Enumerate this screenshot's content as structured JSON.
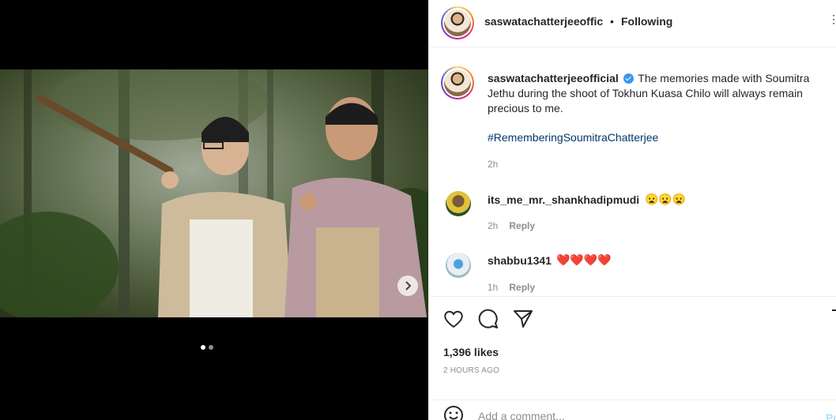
{
  "post": {
    "username": "saswatachatterjeeoffic",
    "separator": "•",
    "follow_status": "Following",
    "more": "⋮"
  },
  "caption": {
    "username": "saswatachatterjeeofficial",
    "text": "The memories made with Soumitra Jethu during the shoot of Tokhun Kuasa Chilo will always remain precious to me.",
    "hashtag": "#RememberingSoumitraChatterjee",
    "age": "2h"
  },
  "comments": [
    {
      "username": "its_me_mr._shankhadipmudi",
      "text": "😦😦😦",
      "age": "2h",
      "reply": "Reply"
    },
    {
      "username": "shabbu1341",
      "text": "❤️❤️❤️❤️",
      "age": "1h",
      "reply": "Reply"
    }
  ],
  "engagement": {
    "likes": "1,396 likes",
    "posted": "2 HOURS AGO"
  },
  "compose": {
    "placeholder": "Add a comment...",
    "post_label": "Po"
  },
  "carousel": {
    "slide_count": 2,
    "active_slide": 1
  },
  "colors": {
    "link_blue": "#00376b",
    "verified_blue": "#3897f0",
    "muted": "#8e8e8e",
    "text": "#262626"
  }
}
